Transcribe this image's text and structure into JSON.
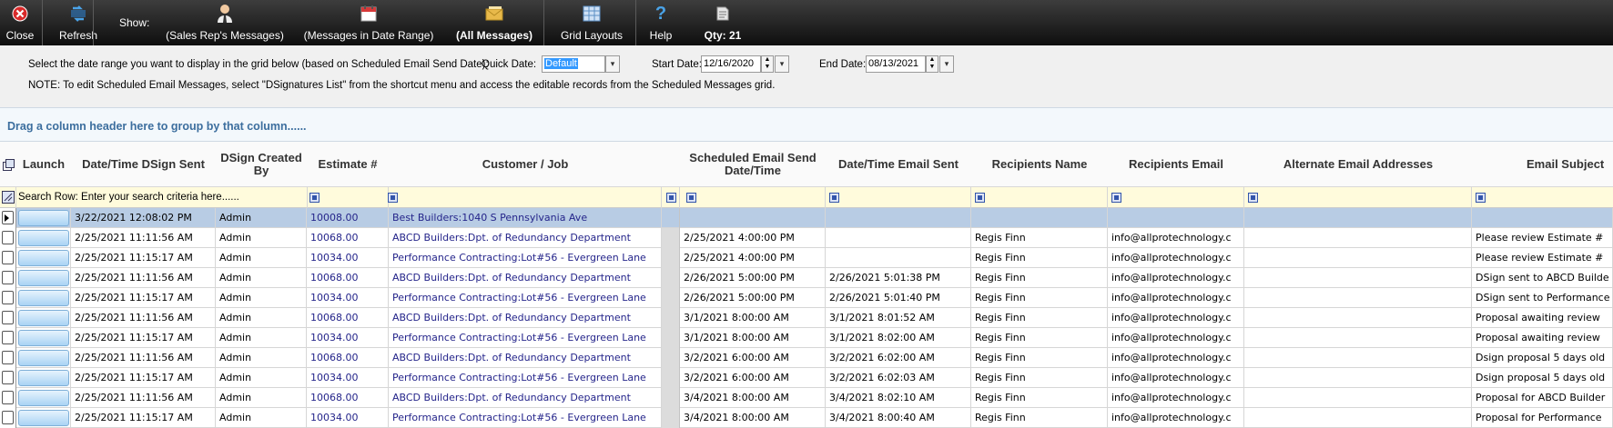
{
  "toolbar": {
    "close": "Close",
    "refresh": "Refresh",
    "show": "Show:",
    "sales_rep": "(Sales Rep's Messages)",
    "date_range": "(Messages in Date Range)",
    "all_messages": "(All Messages)",
    "grid_layouts": "Grid Layouts",
    "help": "Help",
    "qty": "Qty: 21"
  },
  "filters": {
    "instruction": "Select the date range you want to display in the grid below (based on Scheduled Email Send Date):",
    "quick_date_label": "Quick Date:",
    "quick_date_value": "Default",
    "start_date_label": "Start Date:",
    "start_date_value": "12/16/2020",
    "end_date_label": "End Date:",
    "end_date_value": "08/13/2021",
    "note": "NOTE: To edit Scheduled Email Messages, select \"DSignatures List\" from the shortcut menu and access the editable records from the Scheduled Messages grid."
  },
  "group_bar": "Drag a column header here to group by that column......",
  "columns": {
    "launch": "Launch",
    "sent": "Date/Time DSign Sent",
    "created_by": "DSign Created By",
    "estimate": "Estimate #",
    "customer": "Customer / Job",
    "scheduled": "Scheduled Email Send Date/Time",
    "email_sent": "Date/Time Email Sent",
    "recipient_name": "Recipients Name",
    "recipient_email": "Recipients Email",
    "alt_email": "Alternate Email Addresses",
    "subject": "Email Subject"
  },
  "search_row": "Search Row: Enter your search criteria here......",
  "rows": [
    {
      "sent": "3/22/2021 12:08:02 PM",
      "by": "Admin",
      "est": "10008.00",
      "cust": "Best Builders:1040 S Pennsylvania Ave",
      "sched": "",
      "esent": "",
      "rname": "",
      "remail": "",
      "subj": ""
    },
    {
      "sent": "2/25/2021 11:11:56 AM",
      "by": "Admin",
      "est": "10068.00",
      "cust": "ABCD Builders:Dpt. of Redundancy Department",
      "sched": "2/25/2021 4:00:00 PM",
      "esent": "",
      "rname": "Regis Finn",
      "remail": "info@allprotechnology.c",
      "subj": "Please review Estimate #"
    },
    {
      "sent": "2/25/2021 11:15:17 AM",
      "by": "Admin",
      "est": "10034.00",
      "cust": "Performance Contracting:Lot#56 - Evergreen Lane",
      "sched": "2/25/2021 4:00:00 PM",
      "esent": "",
      "rname": "Regis Finn",
      "remail": "info@allprotechnology.c",
      "subj": "Please review Estimate #"
    },
    {
      "sent": "2/25/2021 11:11:56 AM",
      "by": "Admin",
      "est": "10068.00",
      "cust": "ABCD Builders:Dpt. of Redundancy Department",
      "sched": "2/26/2021 5:00:00 PM",
      "esent": "2/26/2021 5:01:38 PM",
      "rname": "Regis Finn",
      "remail": "info@allprotechnology.c",
      "subj": "DSign sent to ABCD Builde"
    },
    {
      "sent": "2/25/2021 11:15:17 AM",
      "by": "Admin",
      "est": "10034.00",
      "cust": "Performance Contracting:Lot#56 - Evergreen Lane",
      "sched": "2/26/2021 5:00:00 PM",
      "esent": "2/26/2021 5:01:40 PM",
      "rname": "Regis Finn",
      "remail": "info@allprotechnology.c",
      "subj": "DSign sent to Performance"
    },
    {
      "sent": "2/25/2021 11:11:56 AM",
      "by": "Admin",
      "est": "10068.00",
      "cust": "ABCD Builders:Dpt. of Redundancy Department",
      "sched": "3/1/2021 8:00:00 AM",
      "esent": "3/1/2021 8:01:52 AM",
      "rname": "Regis Finn",
      "remail": "info@allprotechnology.c",
      "subj": "Proposal awaiting review"
    },
    {
      "sent": "2/25/2021 11:15:17 AM",
      "by": "Admin",
      "est": "10034.00",
      "cust": "Performance Contracting:Lot#56 - Evergreen Lane",
      "sched": "3/1/2021 8:00:00 AM",
      "esent": "3/1/2021 8:02:00 AM",
      "rname": "Regis Finn",
      "remail": "info@allprotechnology.c",
      "subj": "Proposal awaiting review"
    },
    {
      "sent": "2/25/2021 11:11:56 AM",
      "by": "Admin",
      "est": "10068.00",
      "cust": "ABCD Builders:Dpt. of Redundancy Department",
      "sched": "3/2/2021 6:00:00 AM",
      "esent": "3/2/2021 6:02:00 AM",
      "rname": "Regis Finn",
      "remail": "info@allprotechnology.c",
      "subj": "Dsign proposal 5 days old"
    },
    {
      "sent": "2/25/2021 11:15:17 AM",
      "by": "Admin",
      "est": "10034.00",
      "cust": "Performance Contracting:Lot#56 - Evergreen Lane",
      "sched": "3/2/2021 6:00:00 AM",
      "esent": "3/2/2021 6:02:03 AM",
      "rname": "Regis Finn",
      "remail": "info@allprotechnology.c",
      "subj": "Dsign proposal 5 days old"
    },
    {
      "sent": "2/25/2021 11:11:56 AM",
      "by": "Admin",
      "est": "10068.00",
      "cust": "ABCD Builders:Dpt. of Redundancy Department",
      "sched": "3/4/2021 8:00:00 AM",
      "esent": "3/4/2021 8:02:10 AM",
      "rname": "Regis Finn",
      "remail": "info@allprotechnology.c",
      "subj": "Proposal for ABCD Builder"
    },
    {
      "sent": "2/25/2021 11:15:17 AM",
      "by": "Admin",
      "est": "10034.00",
      "cust": "Performance Contracting:Lot#56 - Evergreen Lane",
      "sched": "3/4/2021 8:00:00 AM",
      "esent": "3/4/2021 8:00:40 AM",
      "rname": "Regis Finn",
      "remail": "info@allprotechnology.c",
      "subj": "Proposal for Performance"
    }
  ]
}
